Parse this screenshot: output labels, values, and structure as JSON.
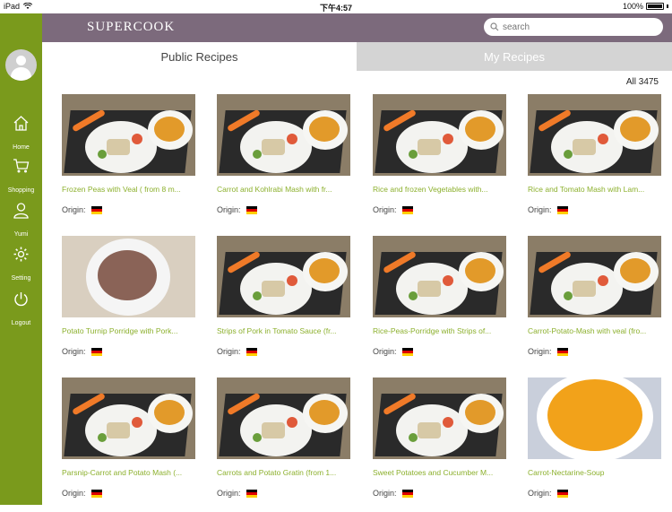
{
  "status_bar": {
    "device": "iPad",
    "time": "下午4:57",
    "battery": "100%"
  },
  "header": {
    "logo": "SUPERCOOK",
    "search_placeholder": "search"
  },
  "sidebar": {
    "items": [
      {
        "label": "Home",
        "icon": "home-icon"
      },
      {
        "label": "Shopping",
        "icon": "cart-icon"
      },
      {
        "label": "Yumi",
        "icon": "user-icon"
      },
      {
        "label": "Setting",
        "icon": "gear-icon"
      },
      {
        "label": "Logout",
        "icon": "power-icon"
      }
    ]
  },
  "tabs": {
    "public": "Public Recipes",
    "my": "My Recipes"
  },
  "count_label": "All 3475",
  "origin_label": "Origin:",
  "flag_colors": [
    "#000000",
    "#dd0000",
    "#ffce00"
  ],
  "recipes": [
    {
      "title": "Frozen Peas with Veal ( from 8 m..."
    },
    {
      "title": "Carrot and Kohlrabi Mash with fr..."
    },
    {
      "title": "Rice and  frozen Vegetables with..."
    },
    {
      "title": "Rice and Tomato Mash with Lam..."
    },
    {
      "title": "Potato Turnip Porridge with Pork..."
    },
    {
      "title": "Strips of Pork in Tomato Sauce (fr..."
    },
    {
      "title": "Rice-Peas-Porridge with Strips of..."
    },
    {
      "title": "Carrot-Potato-Mash with veal (fro..."
    },
    {
      "title": "Parsnip-Carrot and Potato Mash (..."
    },
    {
      "title": "Carrots and Potato Gratin (from 1..."
    },
    {
      "title": "Sweet Potatoes and Cucumber M..."
    },
    {
      "title": "Carrot-Nectarine-Soup"
    }
  ]
}
